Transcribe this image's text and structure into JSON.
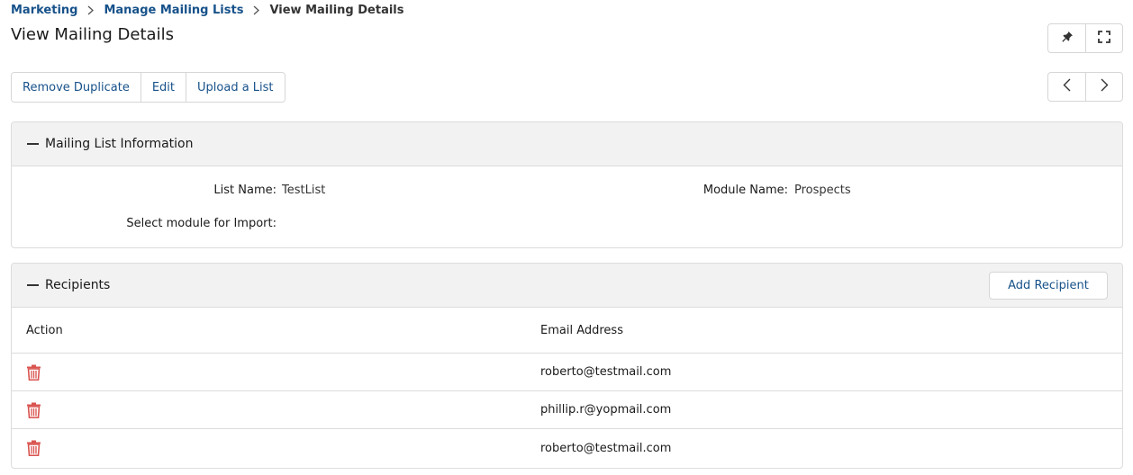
{
  "breadcrumb": {
    "items": [
      "Marketing",
      "Manage Mailing Lists"
    ],
    "current": "View Mailing Details"
  },
  "page_title": "View Mailing Details",
  "toolbar": {
    "remove_duplicate": "Remove Duplicate",
    "edit": "Edit",
    "upload_list": "Upload a List"
  },
  "icons": {
    "pin": "pin-icon",
    "fullscreen": "fullscreen-icon",
    "prev": "chevron-left-icon",
    "next": "chevron-right-icon",
    "trash": "trash-icon",
    "collapse": "collapse-icon"
  },
  "info_panel": {
    "title": "Mailing List Information",
    "list_name_label": "List Name:",
    "list_name_value": "TestList",
    "module_name_label": "Module Name:",
    "module_name_value": "Prospects",
    "select_module_label": "Select module for Import:",
    "select_module_value": ""
  },
  "recipients_panel": {
    "title": "Recipients",
    "add_button": "Add Recipient",
    "columns": [
      "Action",
      "Email Address"
    ],
    "rows": [
      {
        "email": "roberto@testmail.com"
      },
      {
        "email": "phillip.r@yopmail.com"
      },
      {
        "email": "roberto@testmail.com"
      }
    ]
  },
  "colors": {
    "link": "#17528a",
    "trash": "#d9534f",
    "header_bg": "#f2f2f2",
    "border": "#dcdcdc"
  }
}
